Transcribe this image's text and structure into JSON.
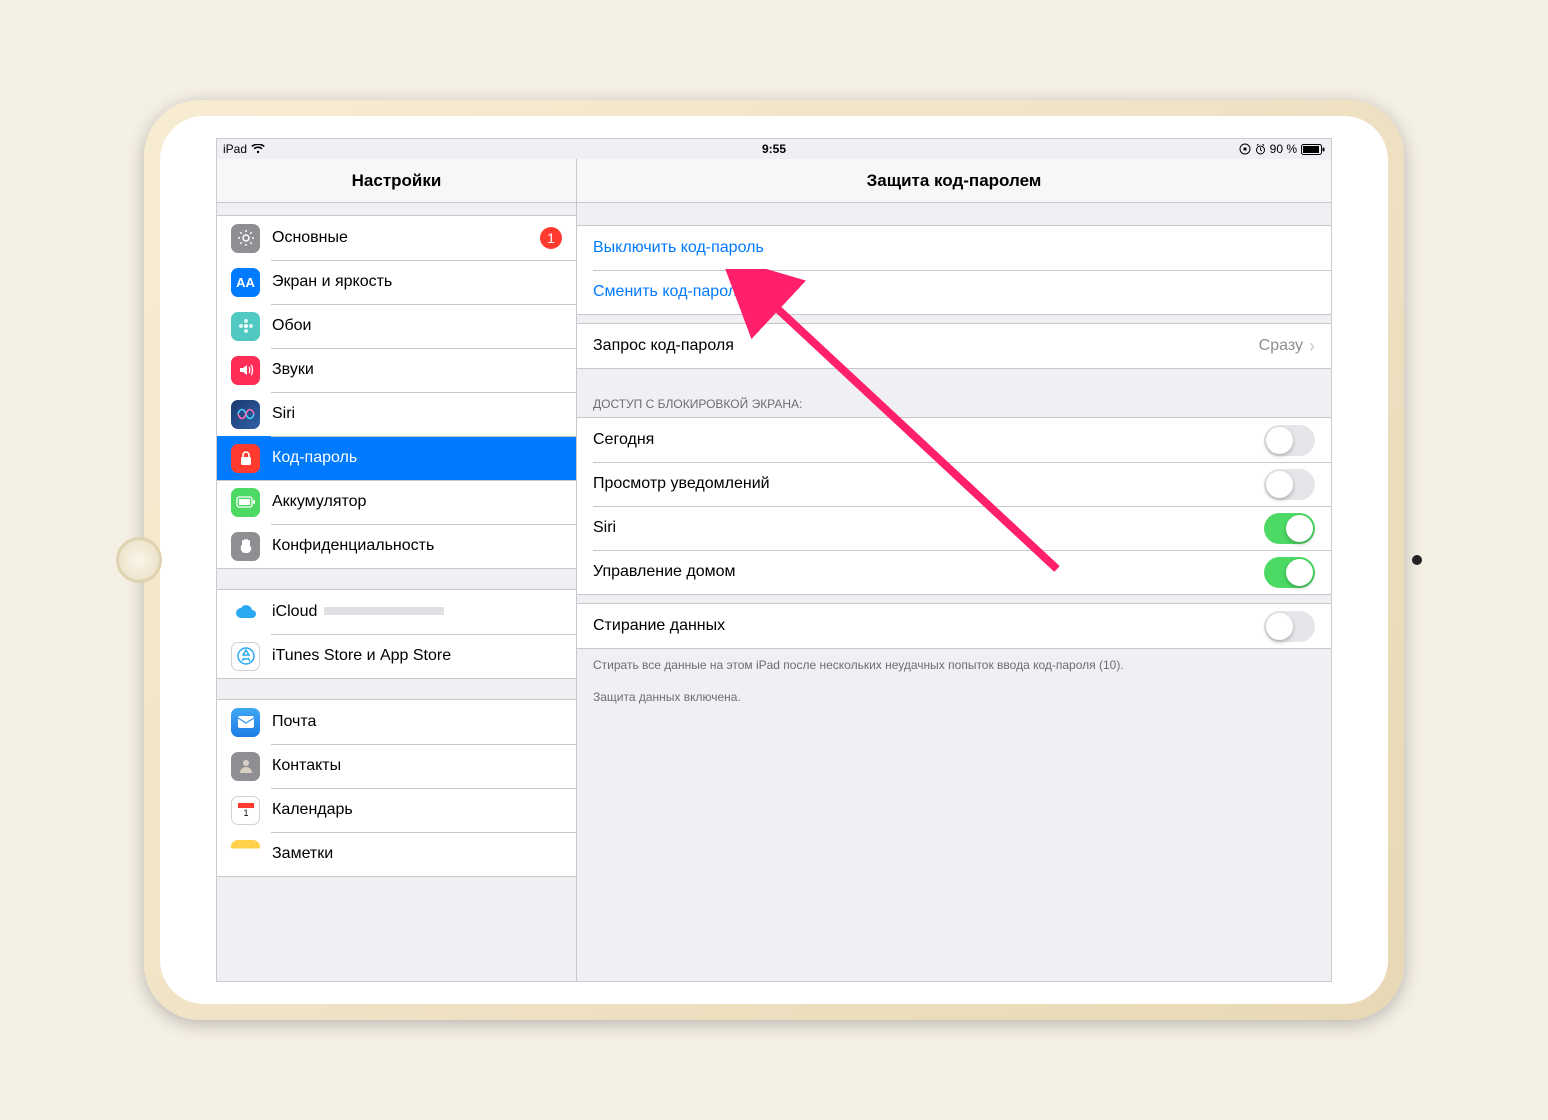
{
  "status": {
    "device": "iPad",
    "time": "9:55",
    "battery": "90 %"
  },
  "sidebar": {
    "title": "Настройки",
    "items": [
      {
        "label": "Основные",
        "badge": "1"
      },
      {
        "label": "Экран и яркость"
      },
      {
        "label": "Обои"
      },
      {
        "label": "Звуки"
      },
      {
        "label": "Siri"
      },
      {
        "label": "Код-пароль"
      },
      {
        "label": "Аккумулятор"
      },
      {
        "label": "Конфиденциальность"
      }
    ],
    "cloudItems": [
      {
        "label": "iCloud"
      },
      {
        "label": "iTunes Store и App Store"
      }
    ],
    "appItems": [
      {
        "label": "Почта"
      },
      {
        "label": "Контакты"
      },
      {
        "label": "Календарь"
      },
      {
        "label": "Заметки"
      }
    ]
  },
  "detail": {
    "title": "Защита код-паролем",
    "turnOff": "Выключить код-пароль",
    "change": "Сменить код-пароль",
    "require": {
      "label": "Запрос код-пароля",
      "value": "Сразу"
    },
    "sectionHeader": "ДОСТУП С БЛОКИРОВКОЙ ЭКРАНА:",
    "toggles": [
      {
        "label": "Сегодня",
        "on": false
      },
      {
        "label": "Просмотр уведомлений",
        "on": false
      },
      {
        "label": "Siri",
        "on": true
      },
      {
        "label": "Управление домом",
        "on": true
      }
    ],
    "erase": {
      "label": "Стирание данных",
      "on": false
    },
    "eraseNote": "Стирать все данные на этом iPad после нескольких неудачных попыток ввода код-пароля (10).",
    "protectedNote": "Защита данных включена."
  }
}
